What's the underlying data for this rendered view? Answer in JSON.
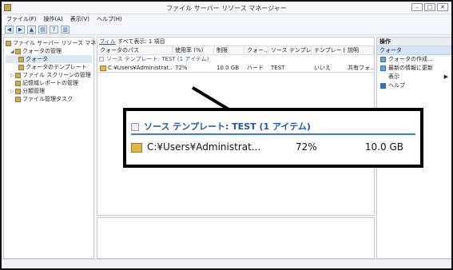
{
  "window": {
    "title": "ファイル サーバー リソース マネージャー",
    "min": "–",
    "max": "□",
    "close": "✕"
  },
  "menu": [
    "ファイル(F)",
    "操作(A)",
    "表示(V)",
    "ヘルプ(H)"
  ],
  "toolbar": {
    "back": "◀",
    "forward": "▶",
    "up": "▲",
    "panel": "▤",
    "help": "?",
    "panel2": "▥"
  },
  "tree": {
    "root": "ファイル サーバー リソース マネージャー",
    "quota_mgmt": "クォータの管理",
    "quota": "クォータ",
    "quota_template": "クォータのテンプレート",
    "screen_mgmt": "ファイル スクリーンの管理",
    "storage_reports": "記憶域レポートの管理",
    "classification": "分類管理",
    "file_tasks": "ファイル管理タスク"
  },
  "list": {
    "filter_link": "フィル",
    "filter_text": "すべて表示: 1 項目",
    "columns": [
      "クォータのパス",
      "使用率 (%)",
      "制限",
      "クォー...",
      "ソース テンプレート",
      "テンプレート...",
      "説明"
    ],
    "group": "ソース テンプレート: TEST (1 アイテム)",
    "rows": [
      [
        "C:¥Users¥Administrat...",
        "72%",
        "10.0 GB",
        "ハード",
        "TEST",
        "いいえ",
        "共有フォ..."
      ]
    ]
  },
  "actions": {
    "header": "操作",
    "section": "クォータ",
    "items": [
      "クォータの作成...",
      "最新の情報に更新",
      "表示",
      "ヘルプ"
    ]
  },
  "callout": {
    "group": "ソース テンプレート: TEST (1 アイテム)",
    "path": "C:¥Users¥Administrat...",
    "usage": "72%",
    "limit": "10.0 GB"
  }
}
